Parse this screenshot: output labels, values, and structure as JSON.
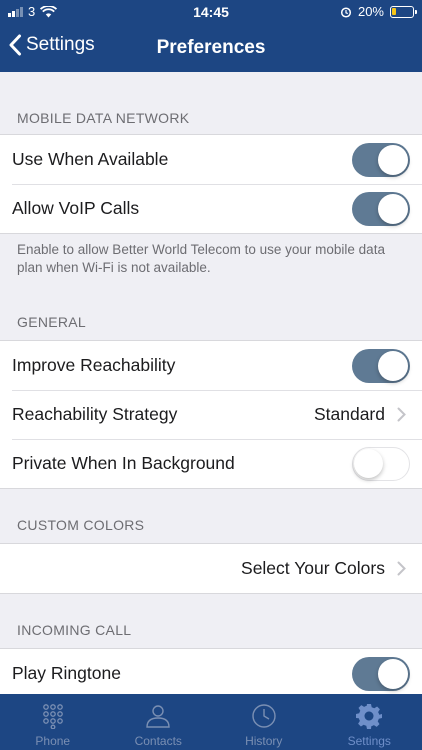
{
  "status_bar": {
    "carrier": "3",
    "time": "14:45",
    "battery_percent": "20%",
    "battery_level": 0.2,
    "icons": [
      "signal-icon",
      "wifi-icon",
      "alarm-icon",
      "battery-icon"
    ]
  },
  "nav": {
    "back_label": "Settings",
    "title": "Preferences"
  },
  "sections": {
    "mobile_data": {
      "header": "MOBILE DATA NETWORK",
      "rows": [
        {
          "label": "Use When Available",
          "toggle": true
        },
        {
          "label": "Allow VoIP Calls",
          "toggle": true
        }
      ],
      "footnote": "Enable to allow Better World Telecom to use your mobile data plan when Wi-Fi is not available."
    },
    "general": {
      "header": "GENERAL",
      "rows": [
        {
          "label": "Improve Reachability",
          "toggle": true
        },
        {
          "label": "Reachability Strategy",
          "value": "Standard"
        },
        {
          "label": "Private When In Background",
          "toggle": false
        }
      ]
    },
    "custom_colors": {
      "header": "CUSTOM COLORS",
      "rows": [
        {
          "value": "Select Your Colors"
        }
      ]
    },
    "incoming_call": {
      "header": "INCOMING CALL",
      "rows": [
        {
          "label": "Play Ringtone",
          "toggle": true
        },
        {
          "label": "",
          "toggle": false
        }
      ]
    }
  },
  "tabs": [
    {
      "label": "Phone",
      "icon": "keypad-icon"
    },
    {
      "label": "Contacts",
      "icon": "person-icon"
    },
    {
      "label": "History",
      "icon": "clock-icon"
    },
    {
      "label": "Settings",
      "icon": "gear-icon",
      "active": true
    }
  ],
  "colors": {
    "header_bg": "#1d4683",
    "toggle_on": "#5f7a94",
    "background": "#efeff4",
    "battery": "#f5c518"
  }
}
